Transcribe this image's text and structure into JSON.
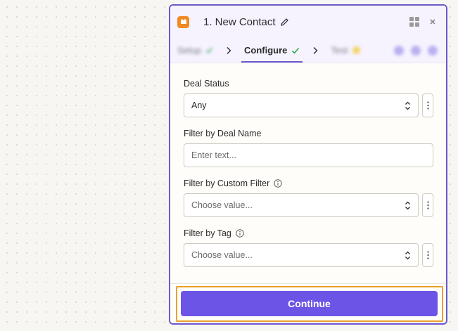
{
  "panel": {
    "title": "1. New Contact"
  },
  "tabs": {
    "setup": "Setup",
    "configure": "Configure",
    "test": "Test"
  },
  "fields": {
    "deal_status": {
      "label": "Deal Status",
      "value": "Any"
    },
    "deal_name": {
      "label": "Filter by Deal Name",
      "placeholder": "Enter text..."
    },
    "custom_filter": {
      "label": "Filter by Custom Filter",
      "value": "Choose value..."
    },
    "tag": {
      "label": "Filter by Tag",
      "value": "Choose value..."
    }
  },
  "footer": {
    "continue_label": "Continue"
  },
  "colors": {
    "accent": "#6c55e6",
    "panel_border": "#6a5acd",
    "highlight": "#e9a12d",
    "app_icon": "#f08a24",
    "check": "#2fa84f"
  },
  "icons": {
    "app": "app-logo-icon",
    "edit": "pencil-icon",
    "grid": "grid-icon",
    "close": "close-icon",
    "chevron": "chevron-right-icon",
    "check": "check-icon",
    "info": "info-icon",
    "select": "up-down-arrows-icon",
    "more": "vertical-dots-icon"
  }
}
